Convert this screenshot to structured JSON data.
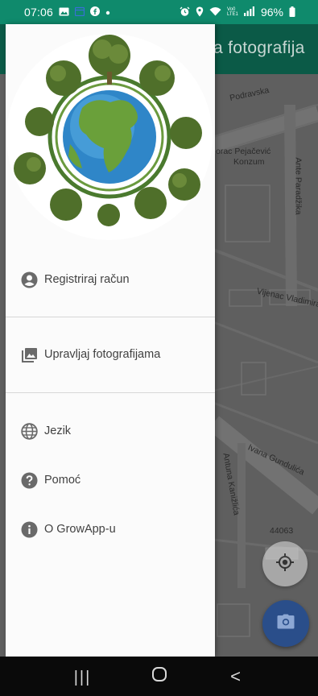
{
  "status_bar": {
    "time": "07:06",
    "left_icons": [
      "image-icon",
      "calendar-icon",
      "facebook-icon",
      "dot-icon"
    ],
    "right_icons": [
      "alarm-icon",
      "location-icon",
      "wifi-icon",
      "volte-icon",
      "signal-icon",
      "battery-icon"
    ],
    "volte_label": "Vo0 LTE1",
    "battery": "96%"
  },
  "app_bar": {
    "title": "a fotografija",
    "color": "#0b5a47"
  },
  "map": {
    "labels": [
      "Podravska",
      "orac Pejačević",
      "Konzum",
      "Ante Paradžika",
      "Vijenac Vladimira N",
      "Ivana Gundulića",
      "Antuna Kanižlića",
      "44063"
    ]
  },
  "drawer": {
    "logo": "growapp-globe-trees-logo",
    "items": [
      {
        "label": "Registriraj račun",
        "icon": "account-circle-icon"
      },
      {
        "label": "Upravljaj fotografijama",
        "icon": "photo-library-icon"
      },
      {
        "label": "Jezik",
        "icon": "globe-icon"
      },
      {
        "label": "Pomoć",
        "icon": "help-circle-icon"
      },
      {
        "label": "O GrowApp-u",
        "icon": "info-icon"
      }
    ]
  },
  "fabs": {
    "location": "my-location-icon",
    "camera": "camera-icon",
    "camera_color": "#2a4e8a"
  },
  "nav_bar": {
    "buttons": [
      "recent-apps-icon",
      "home-icon",
      "back-icon"
    ],
    "recent_glyph": "|||",
    "back_glyph": "<"
  },
  "colors": {
    "status_bar": "#0f8a6c",
    "drawer_bg": "#fbfbfb",
    "map_overlay": "#5f5f5f"
  }
}
